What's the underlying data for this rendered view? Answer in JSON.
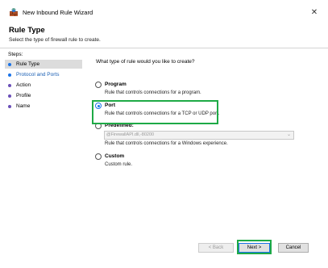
{
  "window": {
    "title": "New Inbound Rule Wizard",
    "close_glyph": "✕"
  },
  "header": {
    "heading": "Rule Type",
    "subheading": "Select the type of firewall rule to create."
  },
  "steps": {
    "label": "Steps:",
    "items": [
      {
        "label": "Rule Type",
        "active": true,
        "dot_color": "#1a73e8"
      },
      {
        "label": "Protocol and Ports",
        "active": false,
        "dot_color": "#1a73e8"
      },
      {
        "label": "Action",
        "active": false,
        "dot_color": "#6a4fb8"
      },
      {
        "label": "Profile",
        "active": false,
        "dot_color": "#6a4fb8"
      },
      {
        "label": "Name",
        "active": false,
        "dot_color": "#6a4fb8"
      }
    ]
  },
  "content": {
    "question": "What type of rule would you like to create?",
    "options": [
      {
        "label": "Program",
        "description": "Rule that controls connections for a program.",
        "checked": false
      },
      {
        "label": "Port",
        "description": "Rule that controls connections for a TCP or UDP port.",
        "checked": true
      },
      {
        "label": "Predefined:",
        "description": "Rule that controls connections for a Windows experience.",
        "checked": false
      },
      {
        "label": "Custom",
        "description": "Custom rule.",
        "checked": false
      }
    ],
    "predefined_select": {
      "value": "@FirewallAPI.dll,-80200",
      "arrow_glyph": "⌄"
    }
  },
  "footer": {
    "back_label": "< Back",
    "next_label": "Next >",
    "cancel_label": "Cancel"
  },
  "colors": {
    "highlight": "#1eaa46",
    "accent": "#1a73e8"
  }
}
